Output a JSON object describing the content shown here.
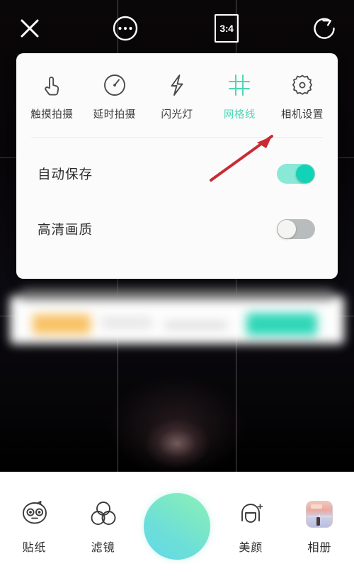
{
  "app": {
    "camera_ratio": "3:4",
    "accent_teal": "#4fd6b6",
    "toggle_on_color": "#12d3b5",
    "toggle_off_color": "#b9bcbd",
    "shutter_gradient_from": "#8ef0b8",
    "shutter_gradient_to": "#62d8e6",
    "annotation_color": "#c92b32"
  },
  "topbar": {
    "close_icon": "close-x-icon",
    "more_icon": "more-dots-circle-icon",
    "ratio_label": "3:4",
    "flip_icon": "camera-flip-icon"
  },
  "panel": {
    "quick_items": [
      {
        "label": "触摸拍摄",
        "icon": "hand-tap-icon",
        "active": false
      },
      {
        "label": "延时拍摄",
        "icon": "timer-dial-icon",
        "active": false
      },
      {
        "label": "闪光灯",
        "icon": "flash-bolt-icon",
        "active": false
      },
      {
        "label": "网格线",
        "icon": "grid-lines-icon",
        "active": true
      },
      {
        "label": "相机设置",
        "icon": "gear-icon",
        "active": false
      }
    ],
    "settings": [
      {
        "label": "自动保存",
        "state": "on",
        "toggle_name": "auto-save-toggle"
      },
      {
        "label": "高清画质",
        "state": "off",
        "toggle_name": "hd-quality-toggle"
      }
    ]
  },
  "bottombar": {
    "items": [
      {
        "label": "贴纸",
        "icon": "sticker-face-icon"
      },
      {
        "label": "滤镜",
        "icon": "filter-circles-icon"
      },
      {
        "label": "美颜",
        "icon": "beauty-face-icon"
      },
      {
        "label": "相册",
        "icon": "album-thumbnail-icon"
      }
    ],
    "shutter_name": "shutter-button"
  }
}
